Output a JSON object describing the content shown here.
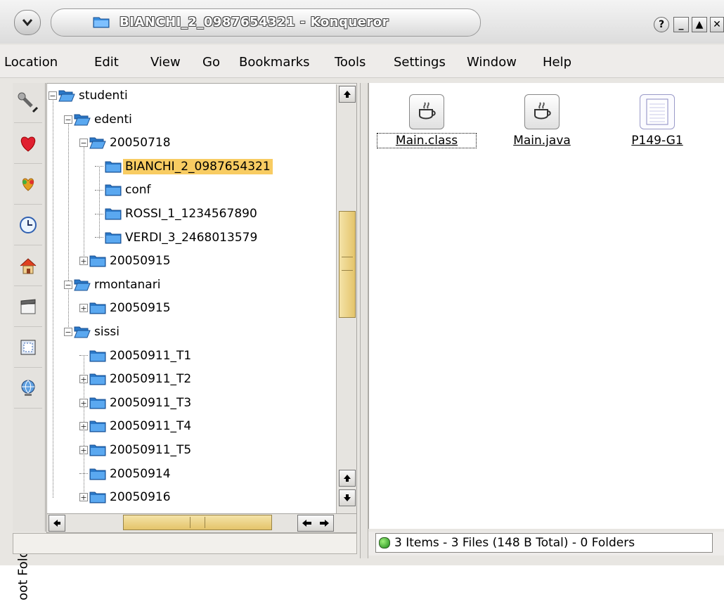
{
  "window": {
    "title": "BIANCHI_2_0987654321 - Konqueror",
    "buttons": {
      "help": "?",
      "minimize": "_",
      "maximize": "▲",
      "close": "✕"
    }
  },
  "menu": [
    "Location",
    "Edit",
    "View",
    "Go",
    "Bookmarks",
    "Tools",
    "Settings",
    "Window",
    "Help"
  ],
  "sidebar": {
    "label": "oot Folder",
    "buttons": [
      "tools-icon",
      "bookmarks-icon",
      "services-icon",
      "history-icon",
      "home-icon",
      "media-icon",
      "devices-icon",
      "network-icon"
    ]
  },
  "tree": [
    {
      "label": "studenti",
      "open": true,
      "sel": false
    },
    {
      "label": "edenti",
      "open": true,
      "sel": false
    },
    {
      "label": "20050718",
      "open": true,
      "sel": false
    },
    {
      "label": "BIANCHI_2_0987654321",
      "open": false,
      "sel": true
    },
    {
      "label": "conf",
      "open": false,
      "sel": false
    },
    {
      "label": "ROSSI_1_1234567890",
      "open": false,
      "sel": false
    },
    {
      "label": "VERDI_3_2468013579",
      "open": false,
      "sel": false
    },
    {
      "label": "20050915",
      "open": false,
      "sel": false
    },
    {
      "label": "rmontanari",
      "open": true,
      "sel": false
    },
    {
      "label": "20050915",
      "open": false,
      "sel": false
    },
    {
      "label": "sissi",
      "open": true,
      "sel": false
    },
    {
      "label": "20050911_T1",
      "open": false,
      "sel": false
    },
    {
      "label": "20050911_T2",
      "open": false,
      "sel": false
    },
    {
      "label": "20050911_T3",
      "open": false,
      "sel": false
    },
    {
      "label": "20050911_T4",
      "open": false,
      "sel": false
    },
    {
      "label": "20050911_T5",
      "open": false,
      "sel": false
    },
    {
      "label": "20050914",
      "open": false,
      "sel": false
    },
    {
      "label": "20050916",
      "open": false,
      "sel": false
    }
  ],
  "files": [
    {
      "name": "Main.class",
      "icon": "java-class-icon"
    },
    {
      "name": "Main.java",
      "icon": "java-source-icon"
    },
    {
      "name": "P149-G1",
      "icon": "text-file-icon"
    }
  ],
  "status": "3 Items - 3 Files (148 B Total) - 0 Folders",
  "colors": {
    "selection": "#f8cc62",
    "folder": "#3a8fe0",
    "scroll_thumb": "#e4c46a"
  }
}
